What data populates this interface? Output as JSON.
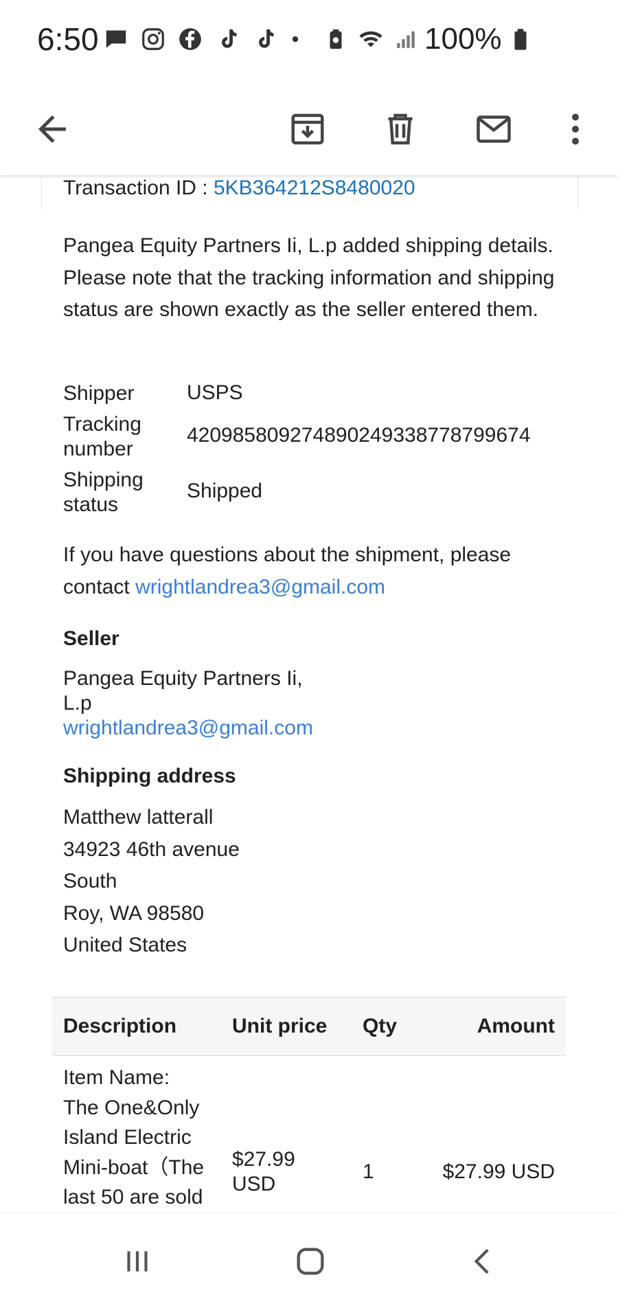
{
  "status_bar": {
    "time": "6:50",
    "battery": "100%"
  },
  "toolbar": {
    "back": "back-arrow-icon",
    "archive": "archive-icon",
    "delete": "trash-icon",
    "mark_unread": "mail-icon",
    "more": "more-vert-icon"
  },
  "email": {
    "transaction_label": "Transaction ID : ",
    "transaction_id": "5KB364212S8480020",
    "shipping_note": "Pangea Equity Partners Ii, L.p added shipping details. Please note that the tracking information and shipping status are shown exactly as the seller entered them.",
    "shipper_label": "Shipper",
    "shipper_value": "USPS",
    "tracking_label_1": "Tracking",
    "tracking_label_2": "number",
    "tracking_value": "420985809274890249338778799674",
    "status_label_1": "Shipping",
    "status_label_2": "status",
    "status_value": "Shipped",
    "questions_text": "If you have questions about the shipment, please contact",
    "contact_email": "wrightlandrea3@gmail.com",
    "seller_heading": "Seller",
    "seller_name_1": "Pangea Equity Partners Ii,",
    "seller_name_2": "L.p",
    "seller_email": "wrightlandrea3@gmail.com",
    "shipping_heading": "Shipping address",
    "address": [
      "Matthew latterall",
      "34923 46th avenue",
      "South",
      "Roy, WA 98580",
      "United States"
    ],
    "table": {
      "headers": [
        "Description",
        "Unit price",
        "Qty",
        "Amount"
      ],
      "row": {
        "description_lines": [
          "Item Name:",
          "The One&Only",
          "Island Electric",
          "Mini-boat（The",
          "last 50 are sold"
        ],
        "unit_price_1": "$27.99",
        "unit_price_2": "USD",
        "qty": "1",
        "amount": "$27.99 USD"
      }
    }
  },
  "navbar": {
    "recents": "recents-icon",
    "home": "home-icon",
    "back": "nav-back-icon"
  }
}
